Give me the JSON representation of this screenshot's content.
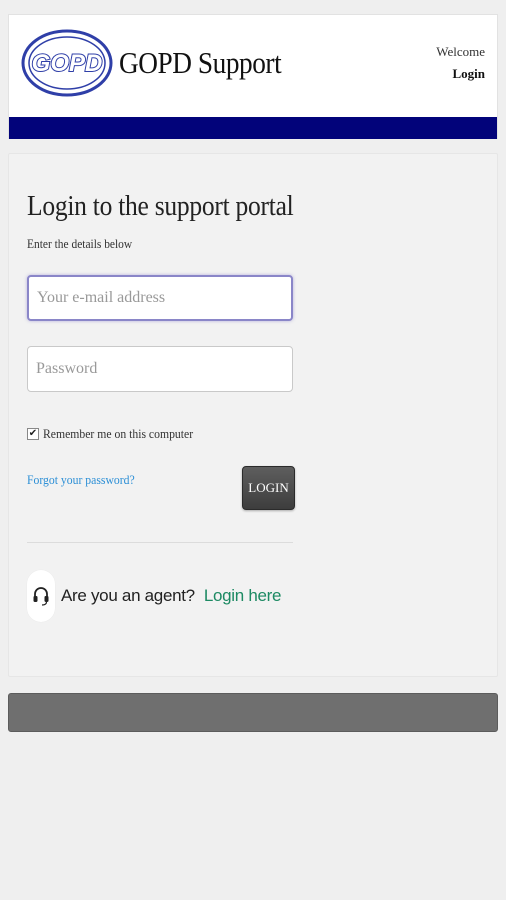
{
  "header": {
    "logo_text": "GOPD",
    "title": "GOPD Support",
    "welcome": "Welcome",
    "login_link": "Login",
    "bar_color": "#02037a"
  },
  "login": {
    "title": "Login to the support portal",
    "subtitle": "Enter the details below",
    "email_placeholder": "Your e-mail address",
    "email_value": "",
    "password_placeholder": "Password",
    "password_value": "",
    "remember_label": "Remember me on this computer",
    "remember_checked": true,
    "forgot_label": "Forgot your password?",
    "login_button": "LOGIN"
  },
  "agent": {
    "icon": "headset-icon",
    "question": "Are you an agent?",
    "link": "Login here",
    "link_color": "#1d8a63"
  }
}
